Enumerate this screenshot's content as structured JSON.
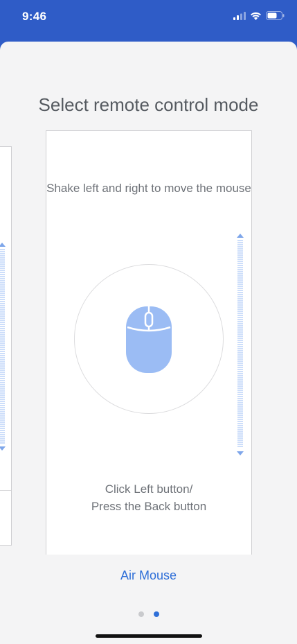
{
  "status_bar": {
    "time": "9:46",
    "icons": [
      "cellular-signal-icon",
      "wifi-icon",
      "battery-icon"
    ]
  },
  "page": {
    "title": "Select remote control mode"
  },
  "cards": [
    {
      "mode": "Air Mouse",
      "top_text": "Shake left and right to move the mouse",
      "bottom_line1": "Click Left button/",
      "bottom_line2": "Press the Back button",
      "icon": "mouse-icon"
    }
  ],
  "pager": {
    "count": 2,
    "active_index": 1,
    "current_label": "Air Mouse"
  },
  "colors": {
    "header": "#2f5cc7",
    "accent": "#2f6fd8",
    "mouse_fill": "#9bbcf4",
    "sheet_bg": "#f4f4f5"
  }
}
